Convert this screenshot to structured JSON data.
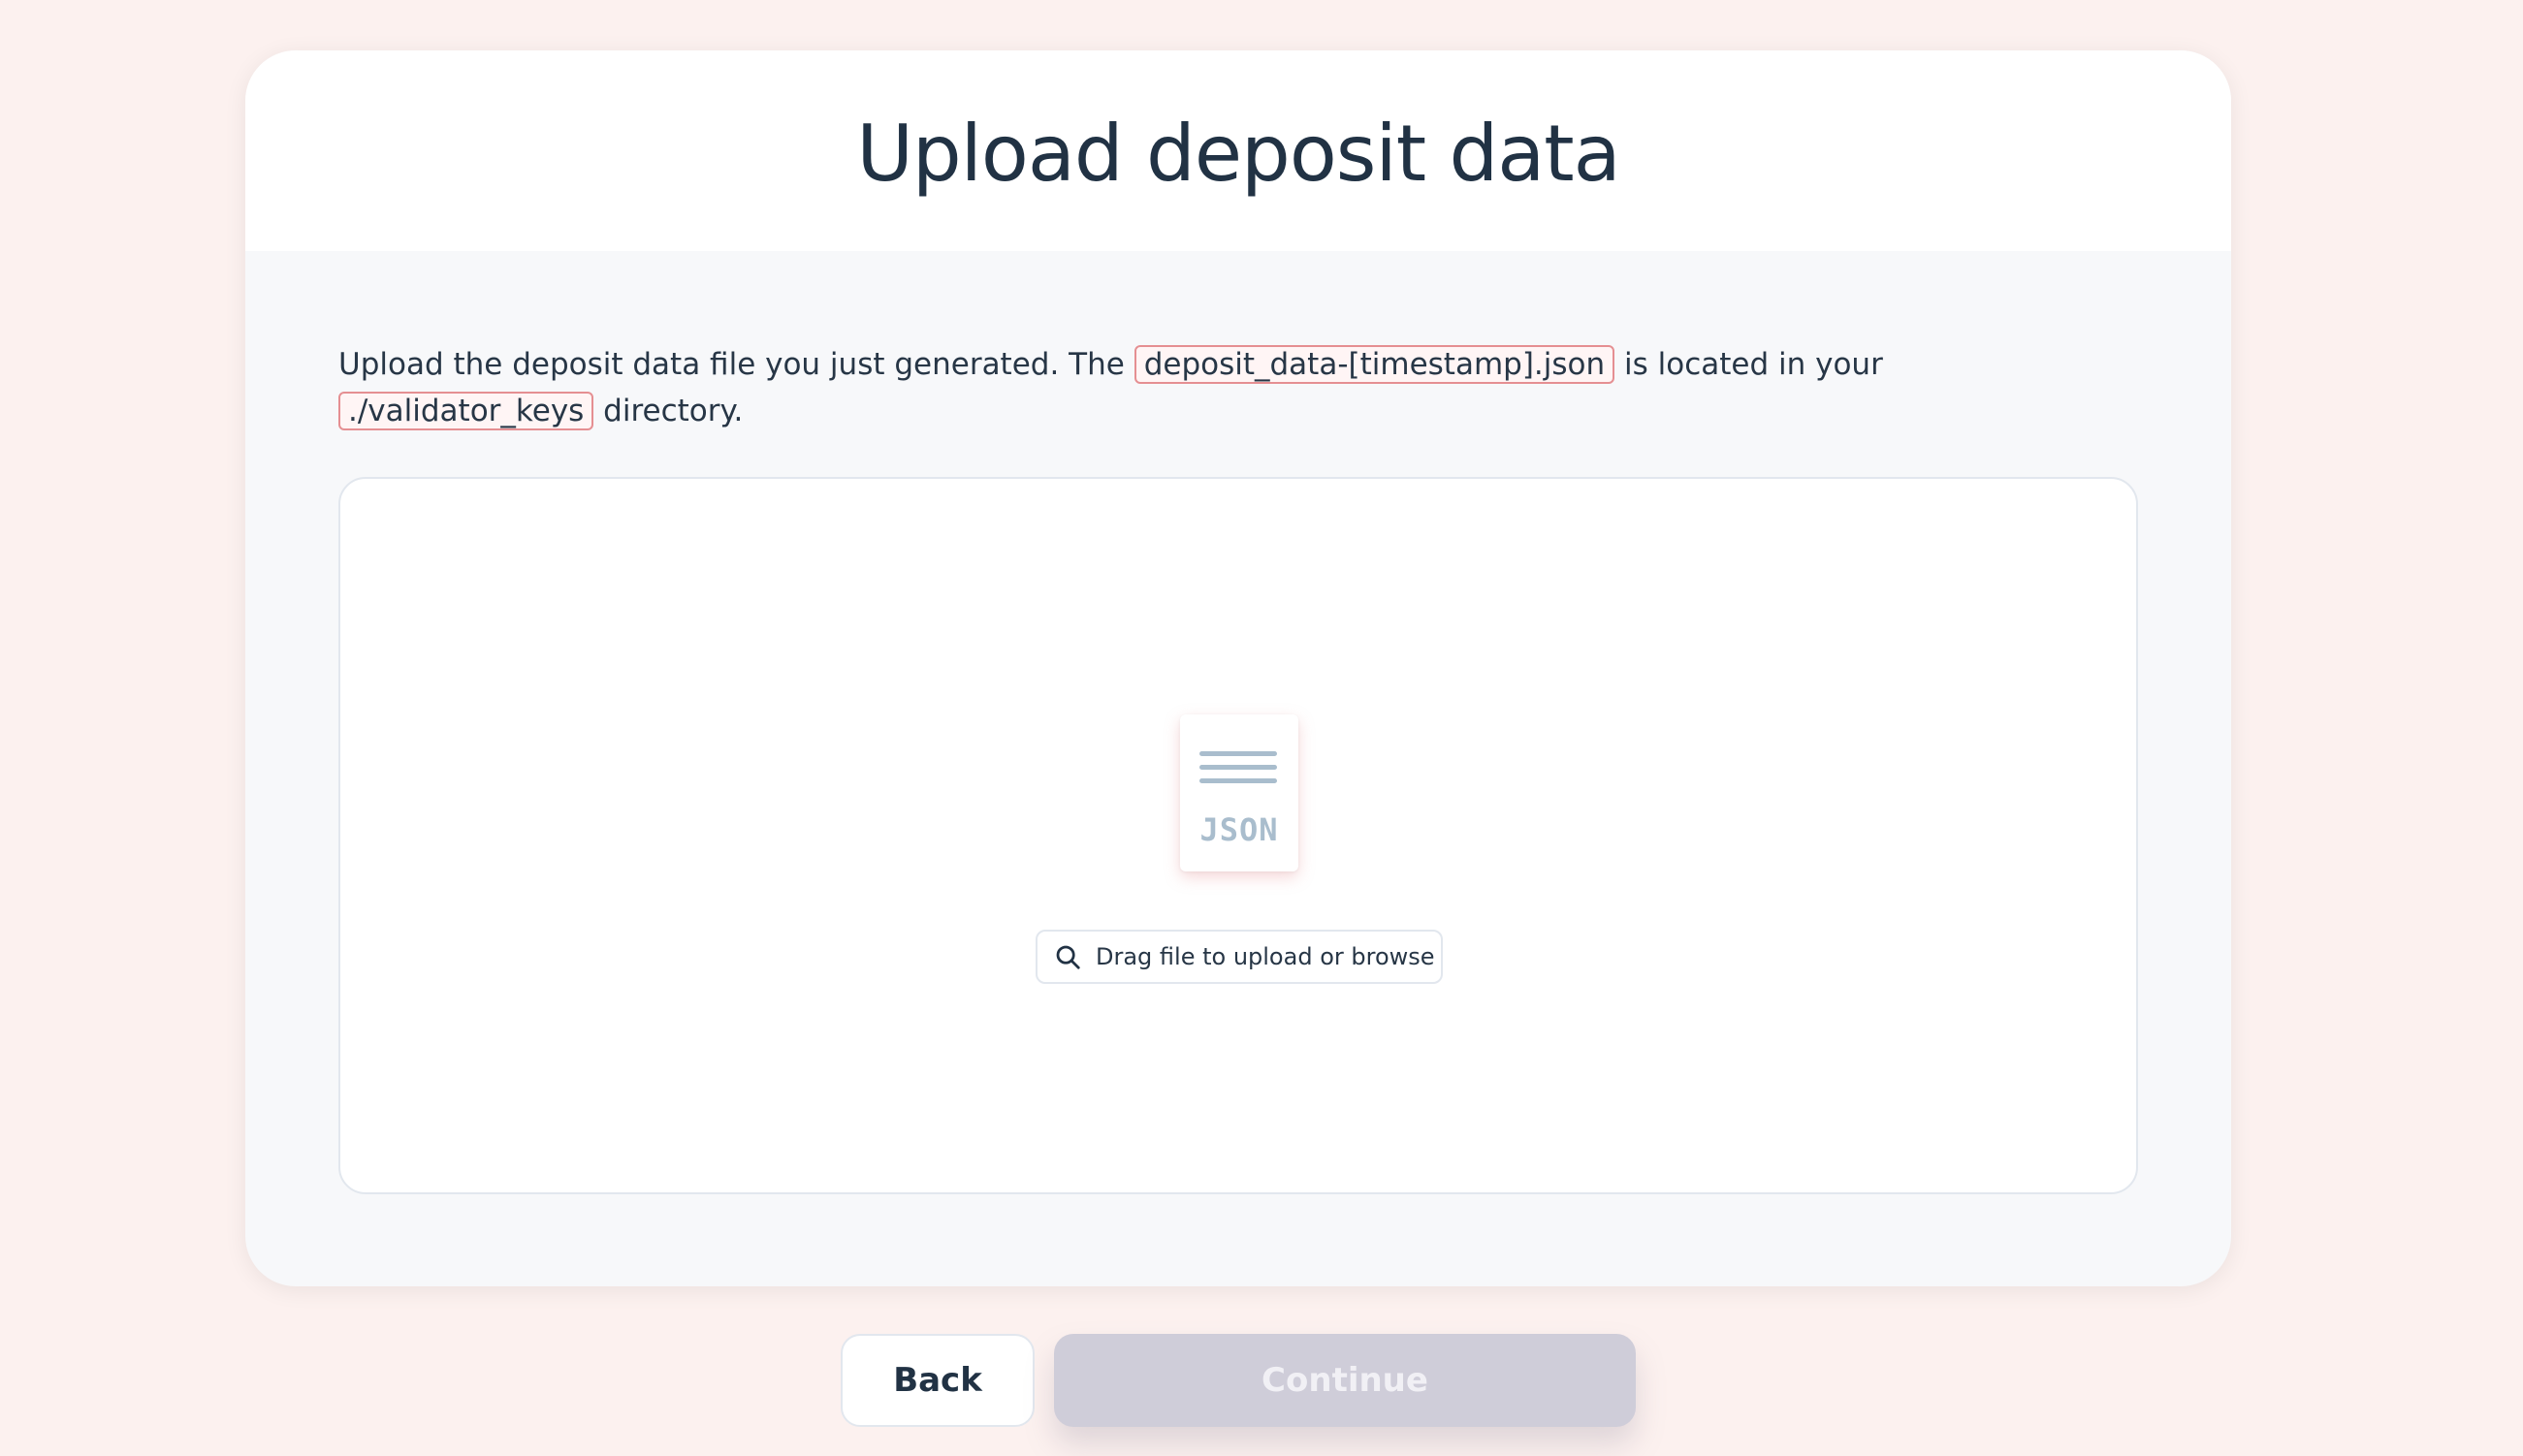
{
  "page": {
    "title": "Upload deposit data"
  },
  "description": {
    "part1": "Upload the deposit data file you just generated. The ",
    "code1": "deposit_data-[timestamp].json",
    "part2": " is located in your ",
    "code2": "./validator_keys",
    "part3": " directory."
  },
  "dropzone": {
    "file_icon": "json-file-icon",
    "file_ext": "JSON",
    "browse_icon": "search-icon",
    "browse_label": "Drag file to upload or browse"
  },
  "actions": {
    "back_label": "Back",
    "continue_label": "Continue",
    "continue_disabled": true
  },
  "colors": {
    "background": "#fcf1ef",
    "code_border": "#e58f92",
    "text": "#273646",
    "disabled_button": "#cfcdd9"
  }
}
